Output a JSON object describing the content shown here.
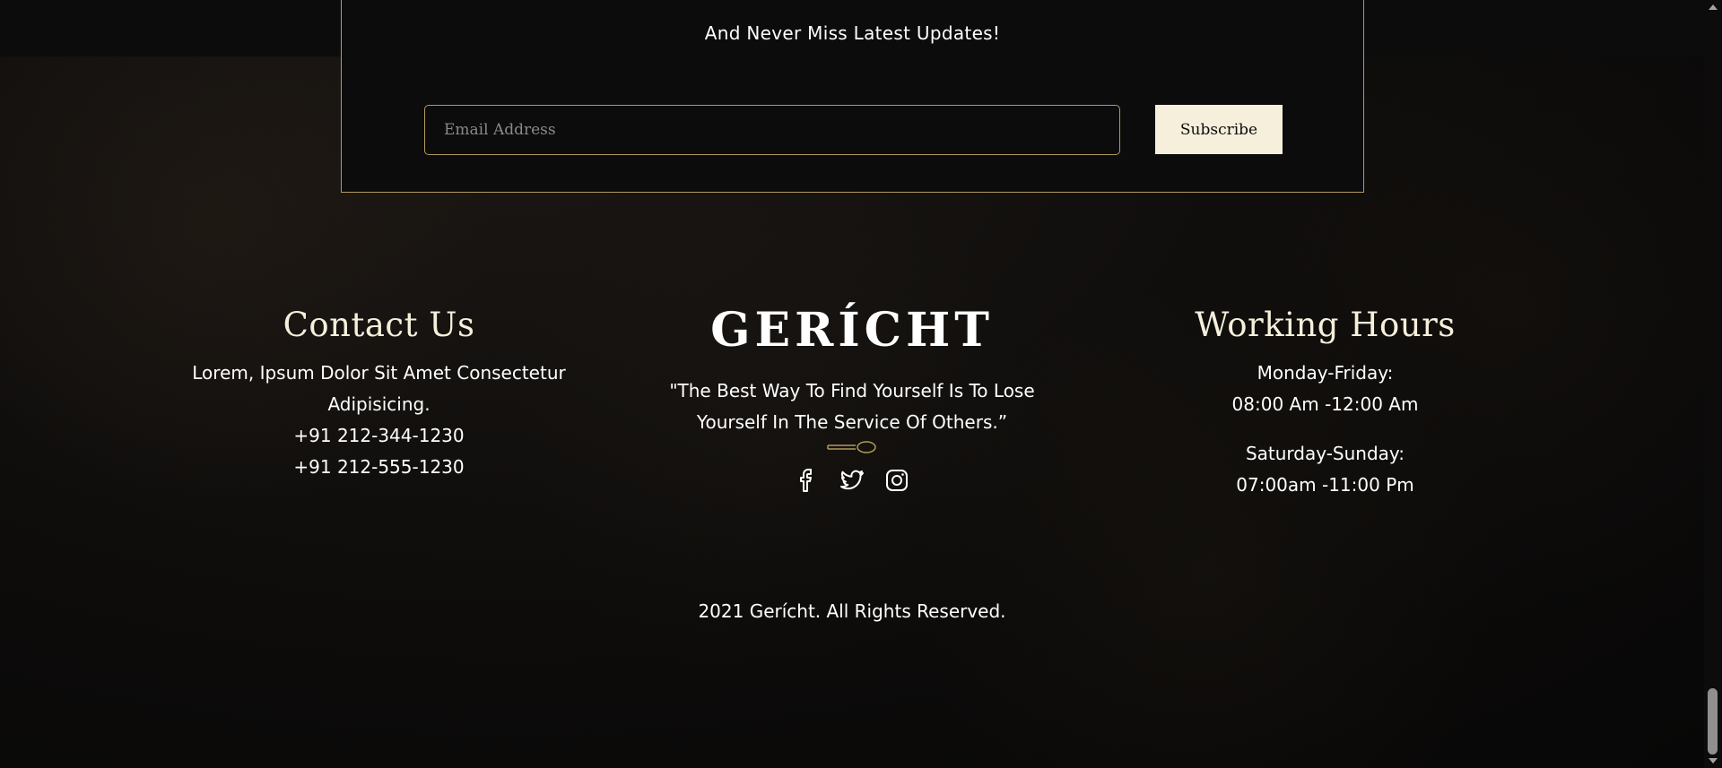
{
  "newsletter": {
    "subtitle": "And Never Miss Latest Updates!",
    "email_placeholder": "Email Address",
    "subscribe_label": "Subscribe"
  },
  "contact": {
    "heading": "Contact Us",
    "address_line1": "Lorem, Ipsum Dolor Sit Amet Consectetur",
    "address_line2": "Adipisicing.",
    "phone1": "+91 212-344-1230",
    "phone2": "+91 212-555-1230"
  },
  "brand": {
    "logo": "GERÍCHT",
    "quote_line1": "\"The Best Way To Find Yourself Is To Lose",
    "quote_line2": "Yourself In The Service Of Others.”",
    "socials": [
      "facebook-icon",
      "twitter-icon",
      "instagram-icon"
    ]
  },
  "hours": {
    "heading": "Working Hours",
    "weekday_label": "Monday-Friday:",
    "weekday_time": "08:00 Am -12:00 Am",
    "weekend_label": "Saturday-Sunday:",
    "weekend_time": "07:00am -11:00 Pm"
  },
  "footer": {
    "copyright": "2021 Gerícht. All Rights Reserved."
  },
  "colors": {
    "accent_gold": "#b29a5d",
    "cream": "#f5efdb",
    "background": "#0c0c0c"
  }
}
